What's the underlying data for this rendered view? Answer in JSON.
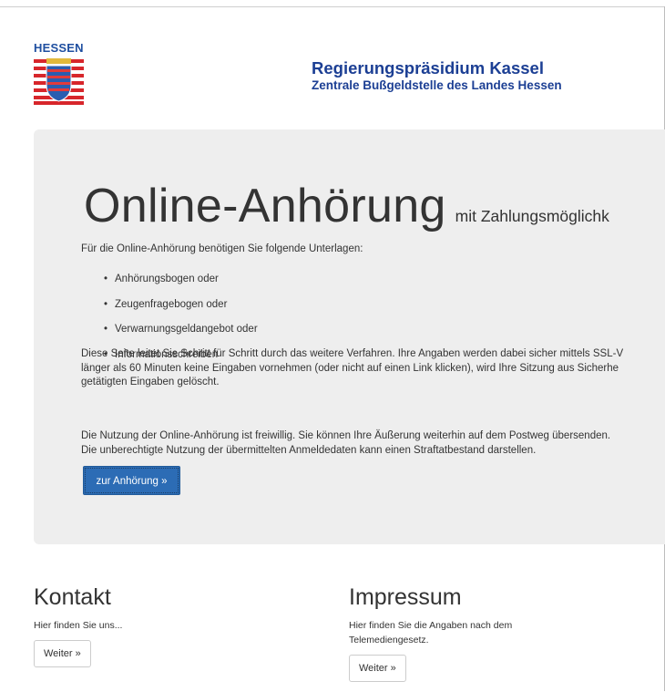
{
  "header": {
    "logo_text": "HESSEN",
    "title": "Regierungspräsidium Kassel",
    "subtitle": "Zentrale Bußgeldstelle des Landes Hessen"
  },
  "jumbotron": {
    "heading": "Online-Anhörung",
    "heading_suffix": "mit Zahlungsmöglichk",
    "intro": "Für die Online-Anhörung benötigen Sie folgende Unterlagen:",
    "documents": [
      "Anhörungsbogen oder",
      "Zeugenfragebogen oder",
      "Verwarnungsgeldangebot oder",
      "Informationsschreiben"
    ],
    "paragraph1_lines": [
      "Diese Seite leitet Sie Schritt für Schritt durch das weitere Verfahren. Ihre Angaben werden dabei sicher mittels SSL-V",
      "länger als 60 Minuten keine Eingaben vornehmen (oder nicht auf einen Link klicken), wird Ihre Sitzung aus Sicherhe",
      "getätigten Eingaben gelöscht."
    ],
    "paragraph2_lines": [
      "Die Nutzung der Online-Anhörung ist freiwillig. Sie können Ihre Äußerung weiterhin auf dem Postweg übersenden.",
      "Die unberechtigte Nutzung der übermittelten Anmeldedaten kann einen Straftatbestand darstellen."
    ],
    "button_label": "zur Anhörung »"
  },
  "kontakt": {
    "title": "Kontakt",
    "text": "Hier finden Sie uns...",
    "button_label": "Weiter »"
  },
  "impressum": {
    "title": "Impressum",
    "text": "Hier finden Sie die Angaben nach dem Telemediengesetz.",
    "button_label": "Weiter »"
  },
  "colors": {
    "brand_blue": "#1c3f94",
    "button_blue": "#2c6cb5",
    "jumbotron_bg": "#eeeeee"
  }
}
